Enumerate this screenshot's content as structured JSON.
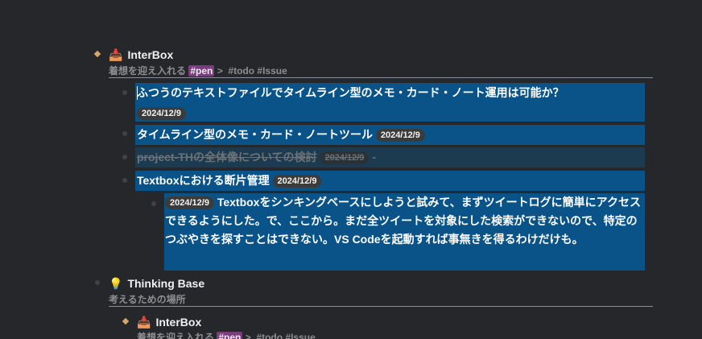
{
  "sections": {
    "interbox_1": {
      "icon": "inbox-tray-icon",
      "emoji": "📥",
      "title": "InterBox",
      "subtitle_text": "着想を迎え入れる",
      "tag_pen": "#pen",
      "separator": ">",
      "tag_todo": "#todo",
      "tag_issue": "#Issue"
    },
    "thinking_base": {
      "icon": "light-bulb-icon",
      "emoji": "💡",
      "title": "Thinking Base",
      "subtitle_text": "考えるための場所"
    },
    "interbox_2": {
      "icon": "inbox-tray-icon",
      "emoji": "📥",
      "title": "InterBox",
      "subtitle_text": "着想を迎え入れる",
      "tag_pen": "#pen",
      "separator": ">",
      "tag_todo": "#todo",
      "tag_issue": "#Issue"
    }
  },
  "items": [
    {
      "text": "ふつうのテキストファイルでタイムライン型のメモ・カード・ノート運用は可能か？",
      "date": "2024/12/9"
    },
    {
      "text": "タイムライン型のメモ・カード・ノートツール",
      "date": "2024/12/9"
    },
    {
      "text": "project-THの全体像についての検討",
      "date": "2024/12/9",
      "suffix": "-",
      "done": true
    },
    {
      "text": "Textboxにおける断片管理",
      "date": "2024/12/9"
    }
  ],
  "subitem": {
    "date": "2024/12/9",
    "text": "Textboxをシンキングベースにしようと試みて、まずツイートログに簡単にアクセスできるようにした。で、ここから。まだ全ツイートを対象にした検索ができないので、特定のつぶやきを探すことはできない。VS Codeを起動すれば事無きを得るわけだけも。"
  }
}
